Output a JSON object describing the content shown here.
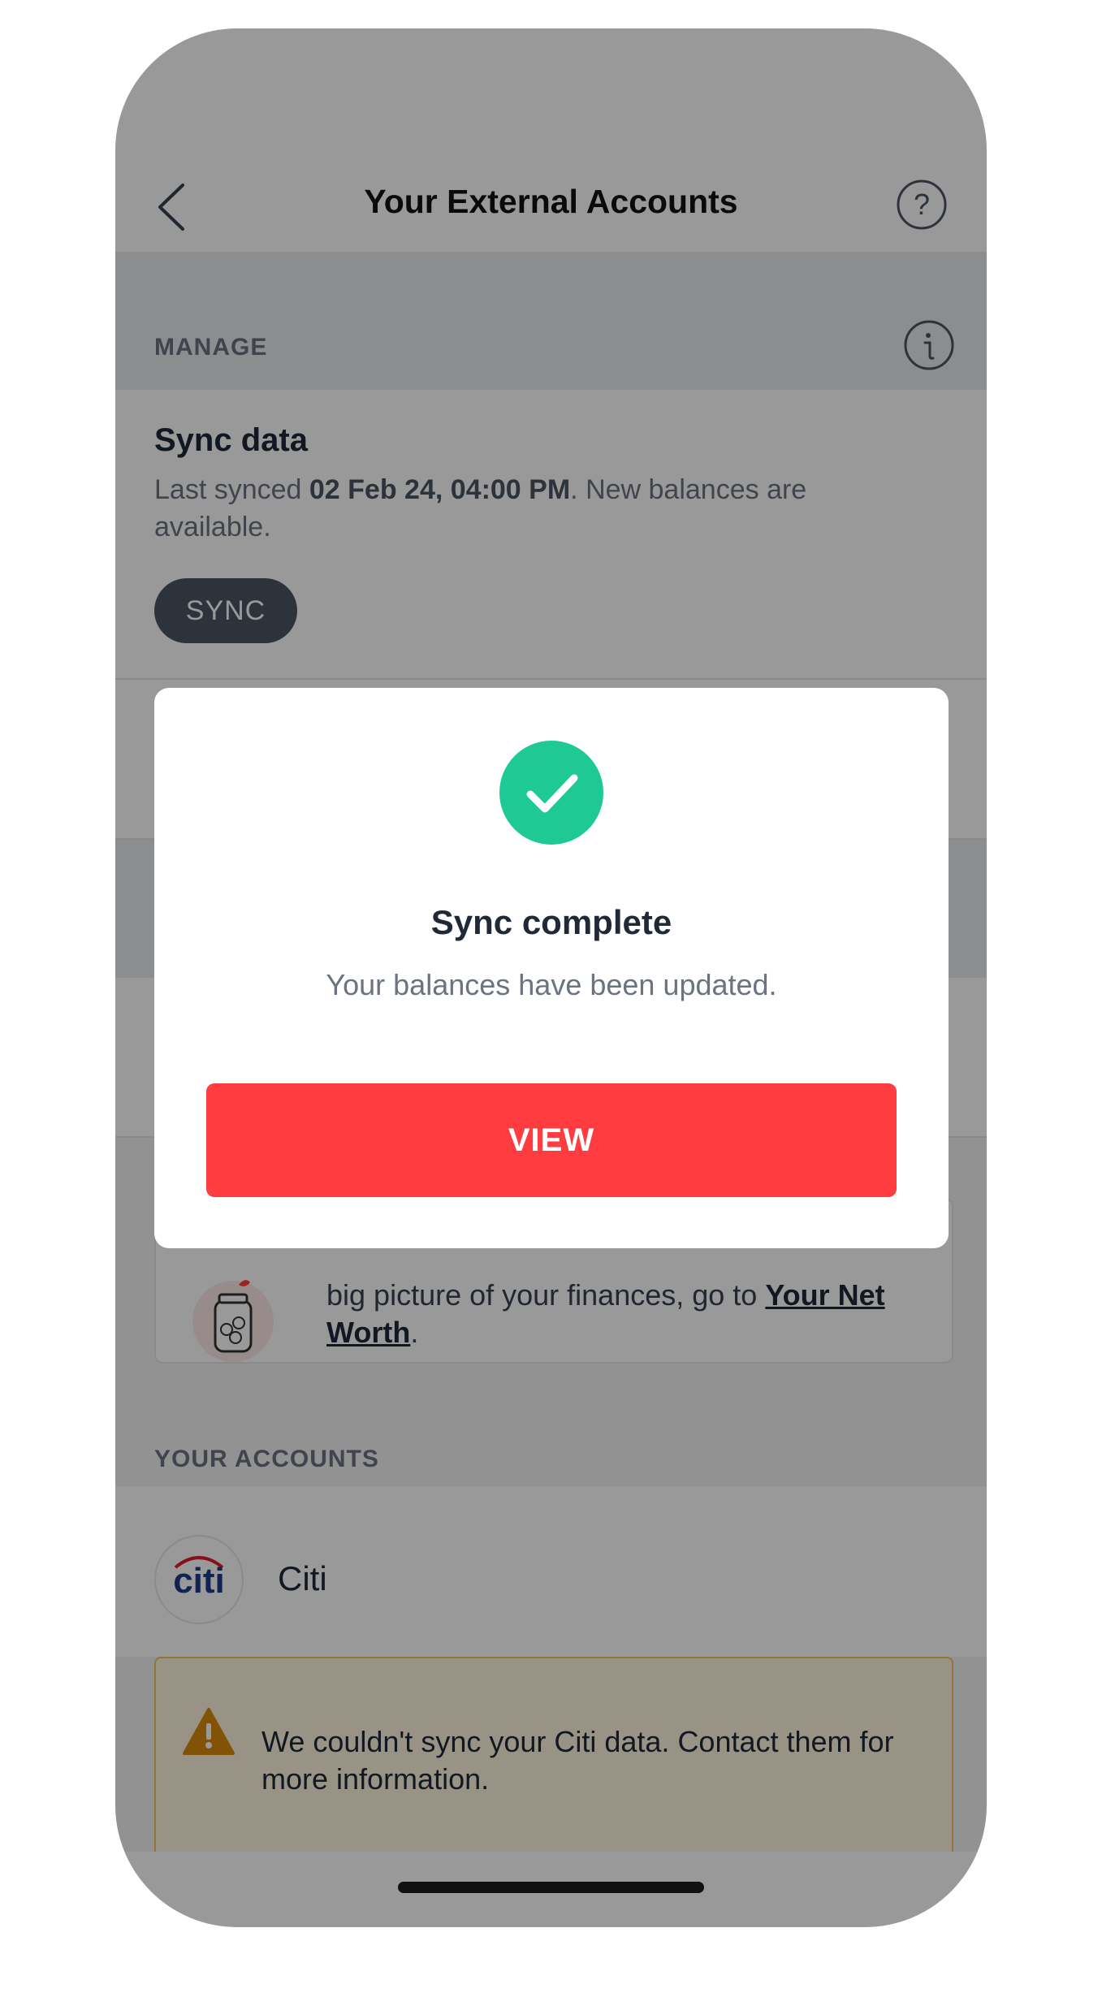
{
  "header": {
    "title": "Your External Accounts",
    "back_icon": "chevron-left-icon",
    "help_icon": "question-circle-icon"
  },
  "manage": {
    "section_label": "MANAGE",
    "info_icon": "info-circle-icon",
    "sync_title": "Sync data",
    "sync_desc_prefix": "Last synced ",
    "sync_desc_time": "02 Feb 24, 04:00 PM",
    "sync_desc_suffix": ". New balances are available.",
    "sync_button": "SYNC"
  },
  "promo": {
    "text_visible": "big picture of your finances, go to ",
    "link_text": "Your Net Worth",
    "text_end": "."
  },
  "accounts": {
    "section_label": "YOUR ACCOUNTS",
    "items": [
      {
        "logo_text": "citi",
        "name": "Citi",
        "warning": "We couldn't sync your Citi data. Contact them for more information."
      }
    ]
  },
  "modal": {
    "title": "Sync complete",
    "subtitle": "Your balances have been updated.",
    "button": "VIEW",
    "icon": "checkmark-circle-icon"
  },
  "colors": {
    "accent_red": "#ff3d40",
    "success_green": "#1fc994",
    "warning_bg": "#fff5df",
    "warning_border": "#f2c45a"
  }
}
